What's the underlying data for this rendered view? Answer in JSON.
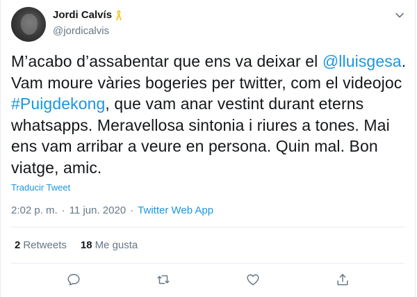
{
  "author": {
    "display_name": "Jordi Calvís",
    "handle": "@jordicalvis"
  },
  "tweet": {
    "t1": "M’acabo d’assabentar que ens va deixar el ",
    "mention": "@lluisgesa",
    "t2": ". Vam moure vàries bogeries per twitter, com el videojoc ",
    "hashtag": "#Puigdekong",
    "t3": ", que vam anar vestint durant eterns whatsapps. Meravellosa sintonia i riures a tones. Mai ens vam arribar a veure en persona. Quin mal. Bon viatge, amic."
  },
  "translate_label": "Traducir Tweet",
  "meta": {
    "time": "2:02 p. m.",
    "separator": "·",
    "date": "11 jun. 2020",
    "source": "Twitter Web App"
  },
  "stats": {
    "retweets_count": "2",
    "retweets_label": "Retweets",
    "likes_count": "18",
    "likes_label": "Me gusta"
  },
  "icons": {
    "ribbon": "yellow-ribbon-icon",
    "caret": "chevron-down-icon",
    "reply": "reply-icon",
    "retweet": "retweet-icon",
    "like": "heart-icon",
    "share": "share-icon"
  },
  "colors": {
    "link": "#1b95e0",
    "ribbon": "#f5c518",
    "secondary_text": "#657786",
    "divider": "#e6ecf0"
  }
}
